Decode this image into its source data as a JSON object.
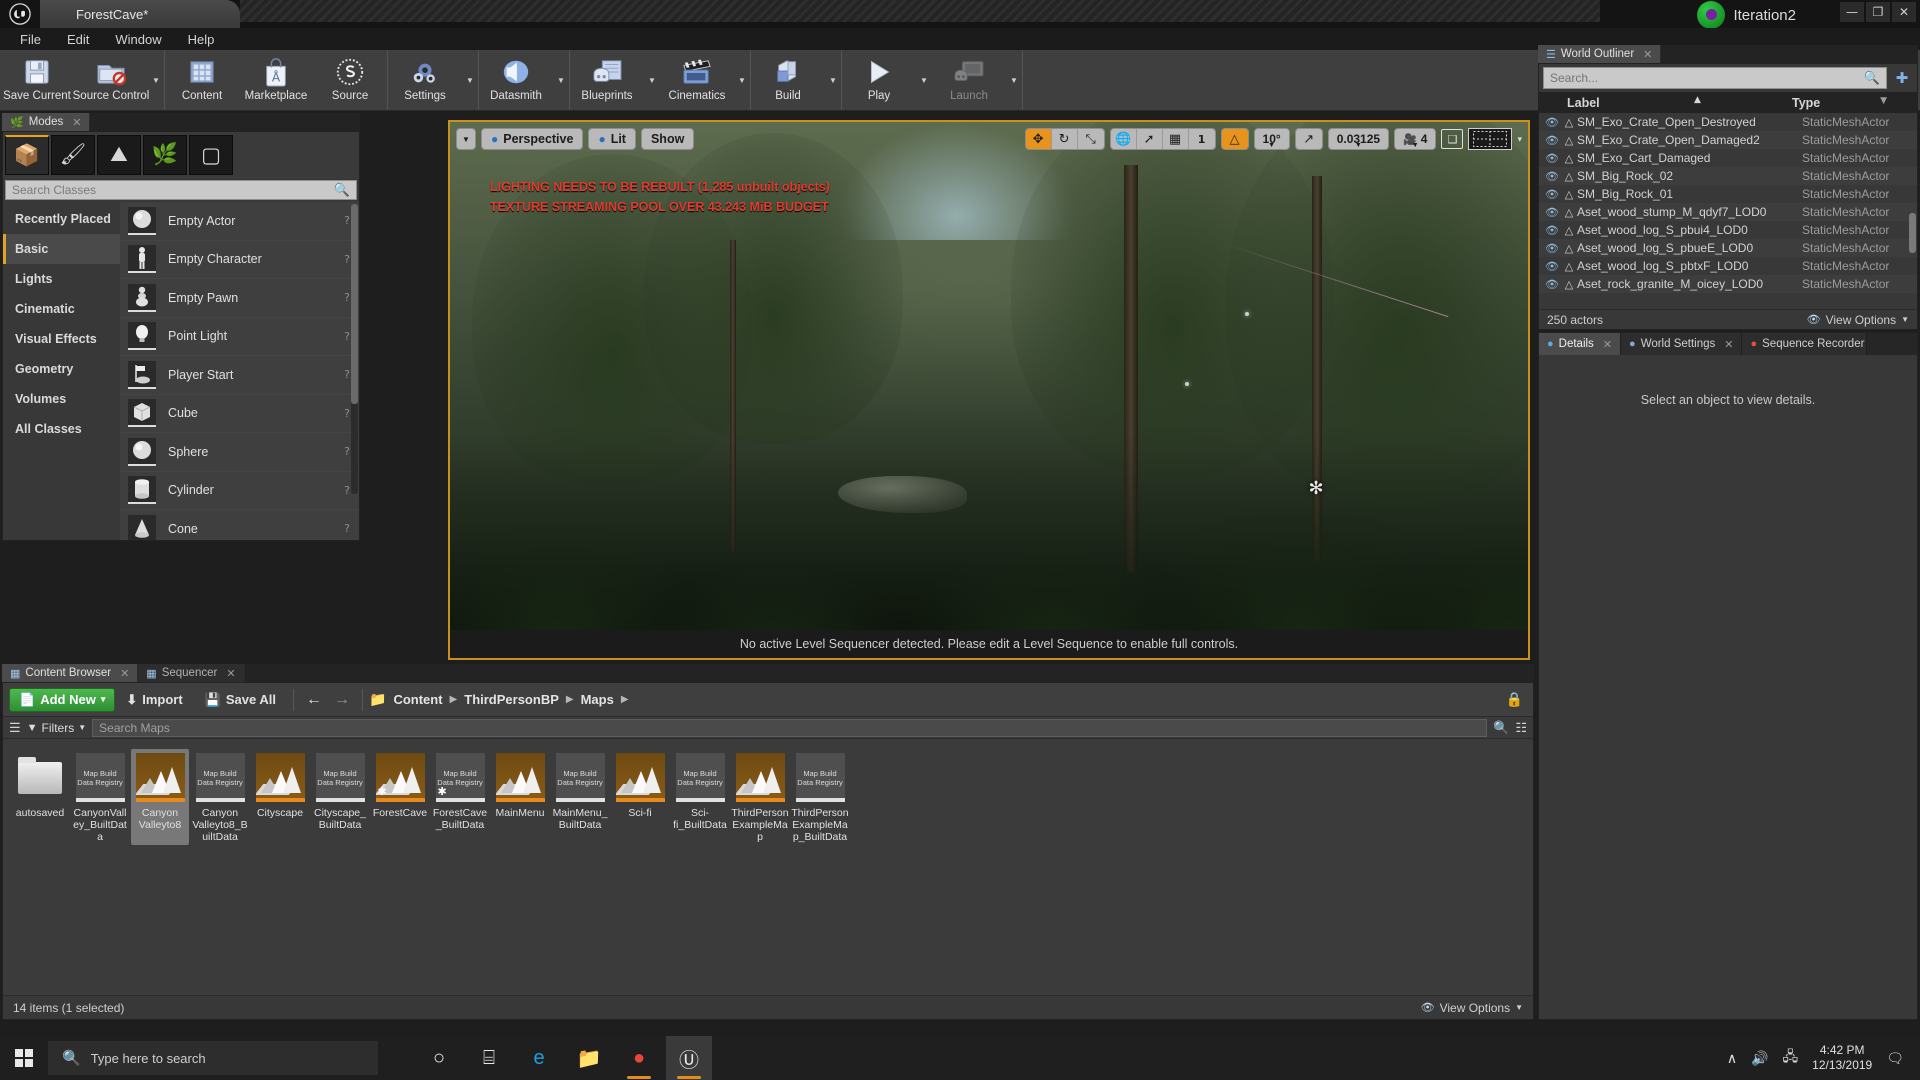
{
  "titlebar": {
    "tab_title": "ForestCave*",
    "logo_icon": "unreal-logo-icon",
    "badge_text": "Iteration2",
    "minimize": "—",
    "maximize": "❐",
    "close": "✕"
  },
  "menubar": {
    "items": [
      "File",
      "Edit",
      "Window",
      "Help"
    ]
  },
  "toolbar": {
    "groups": [
      {
        "buttons": [
          {
            "label": "Save Current",
            "icon": "save-icon",
            "arrow": false,
            "disabled": false
          },
          {
            "label": "Source Control",
            "icon": "source-control-icon",
            "arrow": true,
            "disabled": false
          }
        ]
      },
      {
        "buttons": [
          {
            "label": "Content",
            "icon": "content-icon",
            "arrow": false,
            "disabled": false
          },
          {
            "label": "Marketplace",
            "icon": "marketplace-icon",
            "arrow": false,
            "disabled": false
          },
          {
            "label": "Source",
            "icon": "source-icon",
            "arrow": false,
            "disabled": false
          }
        ]
      },
      {
        "buttons": [
          {
            "label": "Settings",
            "icon": "settings-gear-icon",
            "arrow": true,
            "disabled": false
          }
        ]
      },
      {
        "buttons": [
          {
            "label": "Datasmith",
            "icon": "datasmith-icon",
            "arrow": true,
            "disabled": false
          }
        ]
      },
      {
        "buttons": [
          {
            "label": "Blueprints",
            "icon": "blueprints-icon",
            "arrow": true,
            "disabled": false
          },
          {
            "label": "Cinematics",
            "icon": "cinematics-clapboard-icon",
            "arrow": true,
            "disabled": false
          }
        ]
      },
      {
        "buttons": [
          {
            "label": "Build",
            "icon": "build-icon",
            "arrow": true,
            "disabled": false
          }
        ]
      },
      {
        "buttons": [
          {
            "label": "Play",
            "icon": "play-icon",
            "arrow": true,
            "disabled": false
          },
          {
            "label": "Launch",
            "icon": "launch-icon",
            "arrow": true,
            "disabled": true
          }
        ]
      }
    ]
  },
  "modes": {
    "tab_label": "Modes",
    "tab_icon": "modes-icon",
    "mode_buttons": [
      {
        "name": "place-mode",
        "icon": "📦",
        "active": true
      },
      {
        "name": "paint-mode",
        "icon": "🖌",
        "active": false
      },
      {
        "name": "landscape-mode",
        "icon": "⛰",
        "active": false
      },
      {
        "name": "foliage-mode",
        "icon": "🌿",
        "active": false
      },
      {
        "name": "geometry-editing-mode",
        "icon": "▢",
        "active": false
      }
    ],
    "search_placeholder": "Search Classes",
    "search_value": "",
    "categories": [
      {
        "label": "Recently Placed",
        "active": false
      },
      {
        "label": "Basic",
        "active": true
      },
      {
        "label": "Lights",
        "active": false
      },
      {
        "label": "Cinematic",
        "active": false
      },
      {
        "label": "Visual Effects",
        "active": false
      },
      {
        "label": "Geometry",
        "active": false
      },
      {
        "label": "Volumes",
        "active": false
      },
      {
        "label": "All Classes",
        "active": false
      }
    ],
    "items": [
      {
        "label": "Empty Actor",
        "icon": "sphere-thumb-icon",
        "help": "?"
      },
      {
        "label": "Empty Character",
        "icon": "character-thumb-icon",
        "help": "?"
      },
      {
        "label": "Empty Pawn",
        "icon": "pawn-thumb-icon",
        "help": "?"
      },
      {
        "label": "Point Light",
        "icon": "point-light-thumb-icon",
        "help": "?"
      },
      {
        "label": "Player Start",
        "icon": "player-start-thumb-icon",
        "help": "?"
      },
      {
        "label": "Cube",
        "icon": "cube-thumb-icon",
        "help": "?"
      },
      {
        "label": "Sphere",
        "icon": "sphere-thumb-icon",
        "help": "?"
      },
      {
        "label": "Cylinder",
        "icon": "cylinder-thumb-icon",
        "help": "?"
      },
      {
        "label": "Cone",
        "icon": "cone-thumb-icon",
        "help": "?"
      }
    ]
  },
  "viewport": {
    "view_dropdown_icon": "chevron-down-icon",
    "perspective_label": "Perspective",
    "perspective_icon": "camera-icon",
    "lit_label": "Lit",
    "lit_icon": "lit-sphere-icon",
    "show_label": "Show",
    "transform_tools": [
      {
        "name": "translate-gizmo",
        "icon": "✥",
        "active": true
      },
      {
        "name": "rotate-gizmo",
        "icon": "↻",
        "active": false
      },
      {
        "name": "scale-gizmo",
        "icon": "⤡",
        "active": false
      }
    ],
    "coord_system": {
      "name": "world-coordinate-toggle",
      "icon": "🌐"
    },
    "surface_snap": {
      "name": "surface-snapping-toggle",
      "icon": "⯈"
    },
    "grid_snap_toggle": {
      "name": "grid-snap-toggle",
      "icon": "▦"
    },
    "grid_snap_value": "1",
    "angle_snap_on": true,
    "angle_snap_icon": "△",
    "angle_snap_value": "10°",
    "scale_snap_icon": "↗",
    "scale_snap_value": "0.03125",
    "camera_speed_icon": "camera-speed-icon",
    "camera_speed_value": "4",
    "maximize_icon": "maximize-viewport-icon",
    "layout_icon": "viewport-layout-icon",
    "layout_caret": "▾",
    "warnings": [
      "LIGHTING NEEDS TO BE REBUILT (1,285 unbuilt objects)",
      "TEXTURE STREAMING POOL OVER 43.243 MiB BUDGET"
    ],
    "status_text": "No active Level Sequencer detected. Please edit a Level Sequence to enable full controls."
  },
  "outliner": {
    "tab_label": "World Outliner",
    "tab_icon": "outliner-icon",
    "search_placeholder": "Search...",
    "search_value": "",
    "search_icon": "search-icon",
    "add_icon": "add-item-icon",
    "columns": [
      "Label",
      "Type"
    ],
    "rows": [
      {
        "label": "Aset_rock_granite_M_oicey_LOD0",
        "type": "StaticMeshActor"
      },
      {
        "label": "Aset_wood_log_S_pbtxF_LOD0",
        "type": "StaticMeshActor"
      },
      {
        "label": "Aset_wood_log_S_pbueE_LOD0",
        "type": "StaticMeshActor"
      },
      {
        "label": "Aset_wood_log_S_pbui4_LOD0",
        "type": "StaticMeshActor"
      },
      {
        "label": "Aset_wood_stump_M_qdyf7_LOD0",
        "type": "StaticMeshActor"
      },
      {
        "label": "SM_Big_Rock_01",
        "type": "StaticMeshActor"
      },
      {
        "label": "SM_Big_Rock_02",
        "type": "StaticMeshActor"
      },
      {
        "label": "SM_Exo_Cart_Damaged",
        "type": "StaticMeshActor"
      },
      {
        "label": "SM_Exo_Crate_Open_Damaged2",
        "type": "StaticMeshActor"
      },
      {
        "label": "SM_Exo_Crate_Open_Destroyed",
        "type": "StaticMeshActor"
      }
    ],
    "actor_count": "250 actors",
    "view_options": "View Options",
    "view_options_icon": "eye-icon"
  },
  "details": {
    "tabs": [
      {
        "label": "Details",
        "icon": "details-info-icon",
        "active": true
      },
      {
        "label": "World Settings",
        "icon": "world-settings-icon",
        "active": false
      },
      {
        "label": "Sequence Recorder",
        "icon": "sequence-recorder-icon",
        "active": false
      }
    ],
    "empty_message": "Select an object to view details."
  },
  "content_browser": {
    "tabs": [
      {
        "label": "Content Browser",
        "icon": "content-browser-icon",
        "active": true
      },
      {
        "label": "Sequencer",
        "icon": "sequencer-icon",
        "active": false
      }
    ],
    "add_new_label": "Add New",
    "add_new_icon": "add-new-icon",
    "add_new_caret": "▾",
    "import_label": "Import",
    "import_icon": "import-icon",
    "save_all_label": "Save All",
    "save_all_icon": "save-icon",
    "nav_back_icon": "arrow-left-icon",
    "nav_forward_icon": "arrow-right-icon",
    "folder_icon": "folder-icon",
    "breadcrumbs": [
      "Content",
      "ThirdPersonBP",
      "Maps"
    ],
    "lock_icon": "lock-icon",
    "sources_icon": "sources-panel-icon",
    "filters_label": "Filters",
    "filters_icon": "filter-icon",
    "search_placeholder": "Search Maps",
    "search_value": "",
    "search_icon": "search-icon",
    "assets": [
      {
        "name": "autosaved",
        "kind": "folder",
        "selected": false,
        "star": false
      },
      {
        "name": "CanyonValley_BuiltData",
        "kind": "builtdata",
        "selected": false,
        "star": false,
        "thumb_text": "Map Build Data Registry"
      },
      {
        "name": "Canyon Valleyto8",
        "kind": "map",
        "selected": true,
        "star": false
      },
      {
        "name": "Canyon Valleyto8_BuiltData",
        "kind": "builtdata",
        "selected": false,
        "star": false,
        "thumb_text": "Map Build Data Registry"
      },
      {
        "name": "Cityscape",
        "kind": "map",
        "selected": false,
        "star": false
      },
      {
        "name": "Cityscape_BuiltData",
        "kind": "builtdata",
        "selected": false,
        "star": false,
        "thumb_text": "Map Build Data Registry"
      },
      {
        "name": "ForestCave",
        "kind": "map",
        "selected": false,
        "star": true
      },
      {
        "name": "ForestCave_BuiltData",
        "kind": "builtdata",
        "selected": false,
        "star": true,
        "thumb_text": "Map Build Data Registry"
      },
      {
        "name": "MainMenu",
        "kind": "map",
        "selected": false,
        "star": false
      },
      {
        "name": "MainMenu_BuiltData",
        "kind": "builtdata",
        "selected": false,
        "star": false,
        "thumb_text": "Map Build Data Registry"
      },
      {
        "name": "Sci-fi",
        "kind": "map",
        "selected": false,
        "star": false
      },
      {
        "name": "Sci-fi_BuiltData",
        "kind": "builtdata",
        "selected": false,
        "star": false,
        "thumb_text": "Map Build Data Registry"
      },
      {
        "name": "ThirdPersonExampleMap",
        "kind": "map",
        "selected": false,
        "star": false
      },
      {
        "name": "ThirdPersonExampleMap_BuiltData",
        "kind": "builtdata",
        "selected": false,
        "star": false,
        "thumb_text": "Map Build Data Registry"
      }
    ],
    "status": "14 items (1 selected)",
    "view_options": "View Options",
    "view_options_icon": "eye-icon"
  },
  "taskbar": {
    "start_icon": "windows-start-icon",
    "search_placeholder": "Type here to search",
    "search_icon": "search-icon",
    "apps": [
      {
        "name": "cortana-icon",
        "glyph": "○",
        "active": false,
        "running": false
      },
      {
        "name": "task-view-icon",
        "glyph": "⌸",
        "active": false,
        "running": false
      },
      {
        "name": "edge-icon",
        "glyph": "e",
        "active": false,
        "running": false
      },
      {
        "name": "file-explorer-icon",
        "glyph": "📁",
        "active": false,
        "running": false
      },
      {
        "name": "chrome-icon",
        "glyph": "●",
        "active": false,
        "running": true
      },
      {
        "name": "unreal-engine-icon",
        "glyph": "Ⓤ",
        "active": true,
        "running": true
      }
    ],
    "tray": {
      "chevron_icon": "∧",
      "volume_icon": "🔊",
      "network_icon": "🖧",
      "time": "4:42 PM",
      "date": "12/13/2019",
      "notification_icon": "🗨"
    }
  }
}
